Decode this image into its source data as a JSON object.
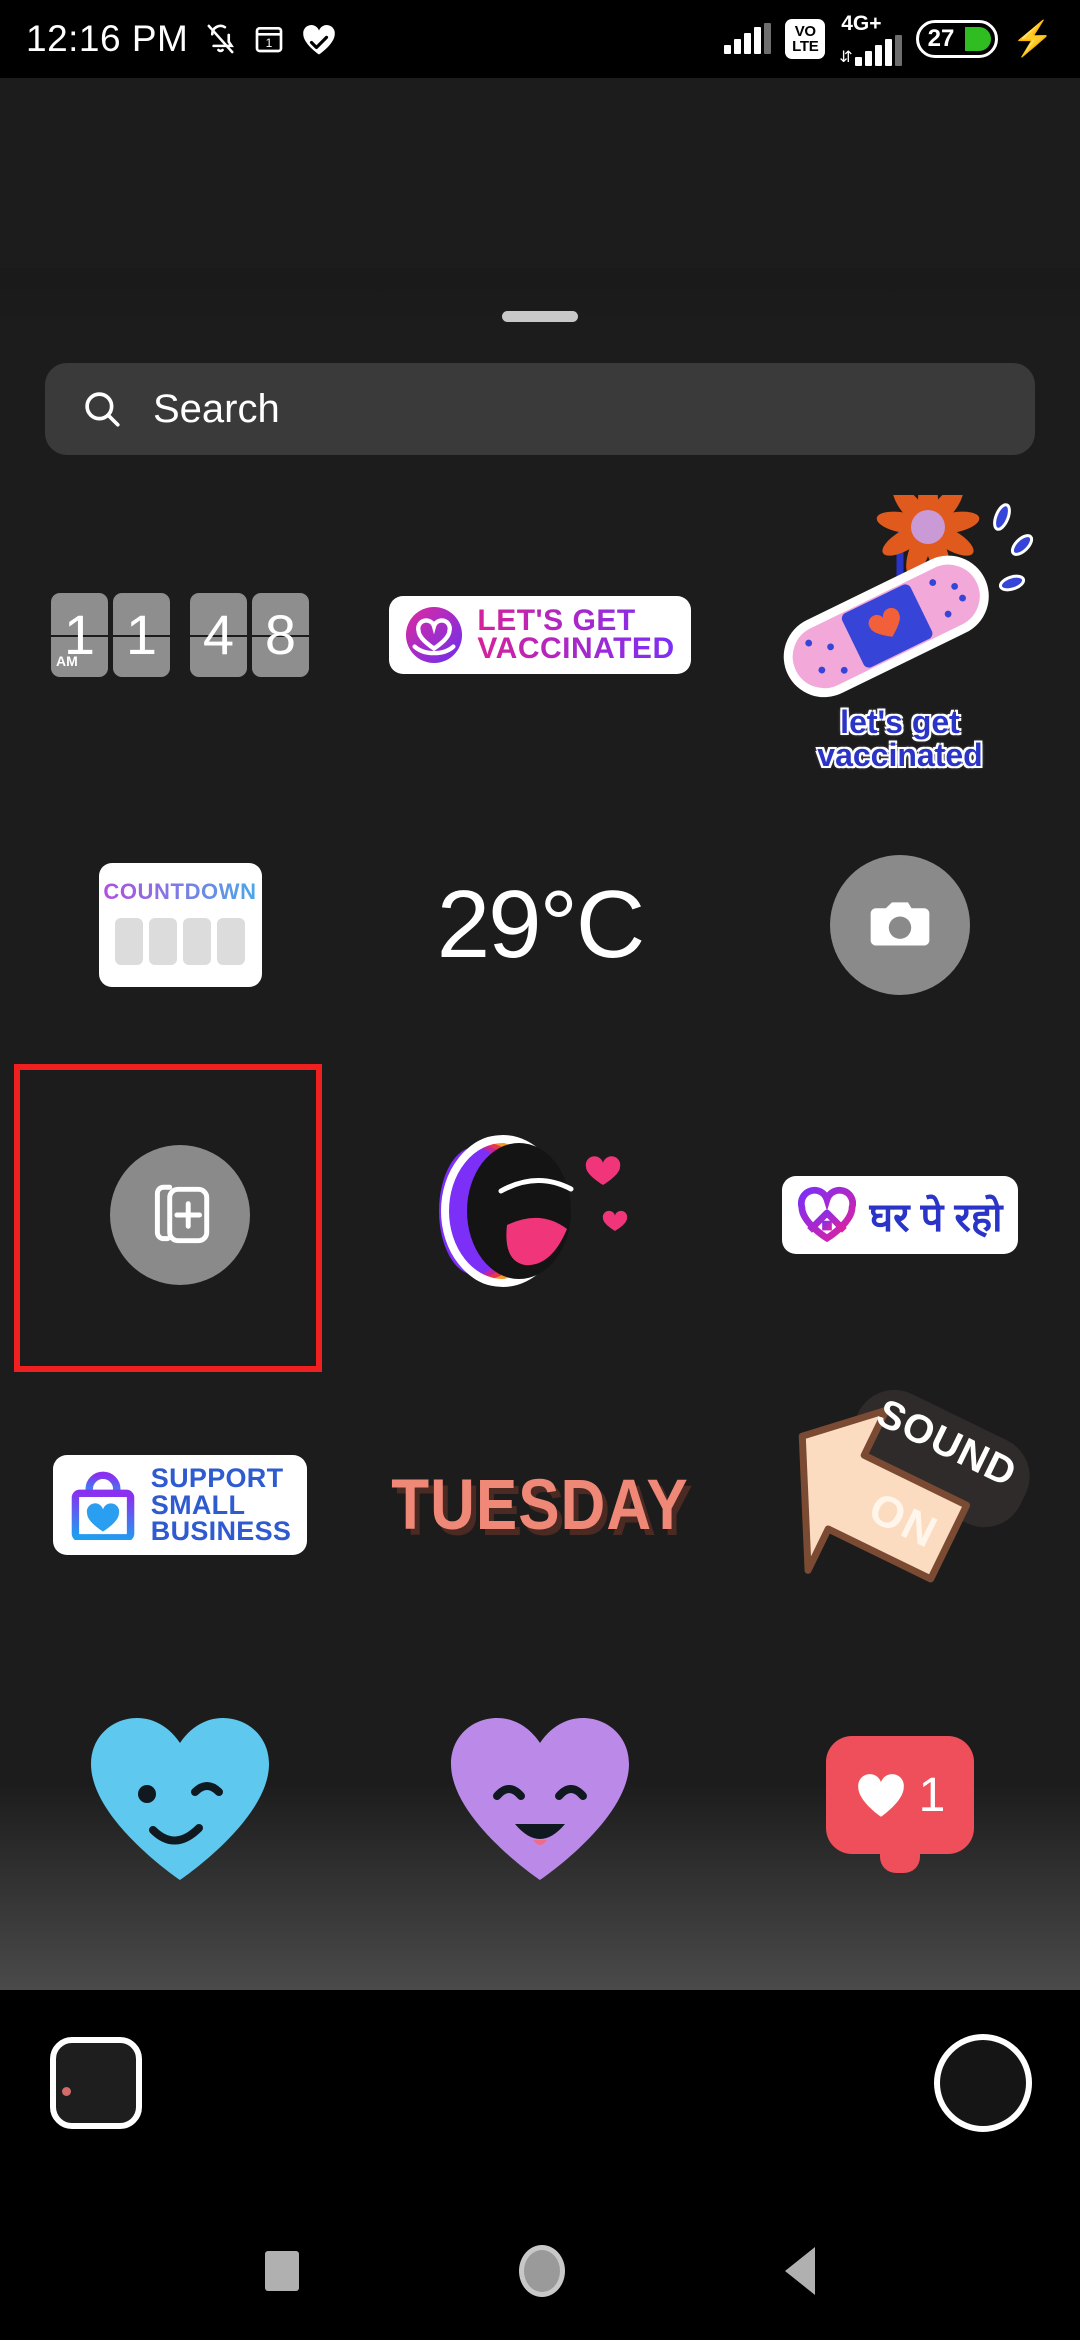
{
  "status_bar": {
    "time": "12:16 PM",
    "icons_left": [
      "bell-off-icon",
      "calendar-1-icon",
      "heart-check-icon"
    ],
    "calendar_day": "1",
    "volte_top": "VO",
    "volte_bottom": "LTE",
    "network_label": "4G+",
    "battery_percent": "27",
    "charging": true,
    "accent_battery": "#2fbd22"
  },
  "tray": {
    "search": {
      "placeholder": "Search",
      "value": ""
    }
  },
  "stickers": [
    {
      "id": "flip-clock",
      "type": "clock",
      "name": "flip-clock-sticker",
      "digits": [
        "1",
        "1",
        "4",
        "8"
      ],
      "ampm": "AM",
      "display": "11:48 AM"
    },
    {
      "id": "lets-get-vaccinated-badge",
      "type": "pill",
      "name": "lets-get-vaccinated-badge-sticker",
      "lines": [
        "LET'S GET",
        "VACCINATED"
      ],
      "logo": "heart-ribbon-icon",
      "gradient_from": "#d6219b",
      "gradient_to": "#7b2ff7"
    },
    {
      "id": "lets-get-vaccinated-bandage",
      "type": "illustration",
      "name": "bandage-flower-vaccinated-sticker",
      "lines": [
        "let's get",
        "vaccinated"
      ],
      "text_color": "#2a35c8",
      "bandage_color": "#f2a8d8",
      "flower_color": "#e05a1e"
    },
    {
      "id": "countdown",
      "type": "widget",
      "name": "countdown-sticker",
      "title": "COUNTDOWN",
      "blocks": 4,
      "gradient_from": "#b14fe0",
      "gradient_to": "#4aa8e8"
    },
    {
      "id": "temperature",
      "type": "text",
      "name": "temperature-sticker",
      "label": "29°C"
    },
    {
      "id": "camera-sticker",
      "type": "button",
      "name": "camera-sticker",
      "icon": "camera-icon"
    },
    {
      "id": "add-photo-sticker",
      "type": "button",
      "name": "add-photo-sticker",
      "icon": "photo-stack-plus-icon",
      "selected": true,
      "selection_color": "#f02020"
    },
    {
      "id": "shout-mouth",
      "type": "illustration",
      "name": "shouting-mouth-sticker",
      "icon": "open-mouth-hearts-icon"
    },
    {
      "id": "ghar-pe-raho",
      "type": "pill",
      "name": "ghar-pe-raho-sticker",
      "label": "घर पे रहो",
      "logo": "heart-house-icon",
      "text_color": "#2a35c8"
    },
    {
      "id": "support-small-business",
      "type": "pill",
      "name": "support-small-business-sticker",
      "lines": [
        "SUPPORT",
        "SMALL",
        "BUSINESS"
      ],
      "logo": "shopping-bag-heart-icon",
      "text_color": "#2f5bd0"
    },
    {
      "id": "tuesday",
      "type": "text",
      "name": "tuesday-sticker",
      "label": "TUESDAY",
      "text_color": "#f08878",
      "shadow_color": "#4a2a22"
    },
    {
      "id": "sound-on",
      "type": "illustration",
      "name": "sound-on-sticker",
      "lines": [
        "SOUND",
        "ON"
      ],
      "arrow": "speaker-arrow-icon"
    },
    {
      "id": "blue-heart-wink",
      "type": "illustration",
      "name": "blue-winking-heart-sticker",
      "color": "#5fc8ee"
    },
    {
      "id": "purple-heart-smile",
      "type": "illustration",
      "name": "purple-smiling-heart-sticker",
      "color": "#bb8ae8"
    },
    {
      "id": "like-badge",
      "type": "badge",
      "name": "like-count-sticker",
      "count": "1",
      "color": "#ef4f5a",
      "icon": "heart-icon"
    }
  ],
  "camera_bar": {
    "gallery_label": "gallery-thumbnail",
    "shutter_label": "shutter-button"
  },
  "nav_bar": {
    "recents": "recents-button",
    "home": "home-button",
    "back": "back-button"
  }
}
